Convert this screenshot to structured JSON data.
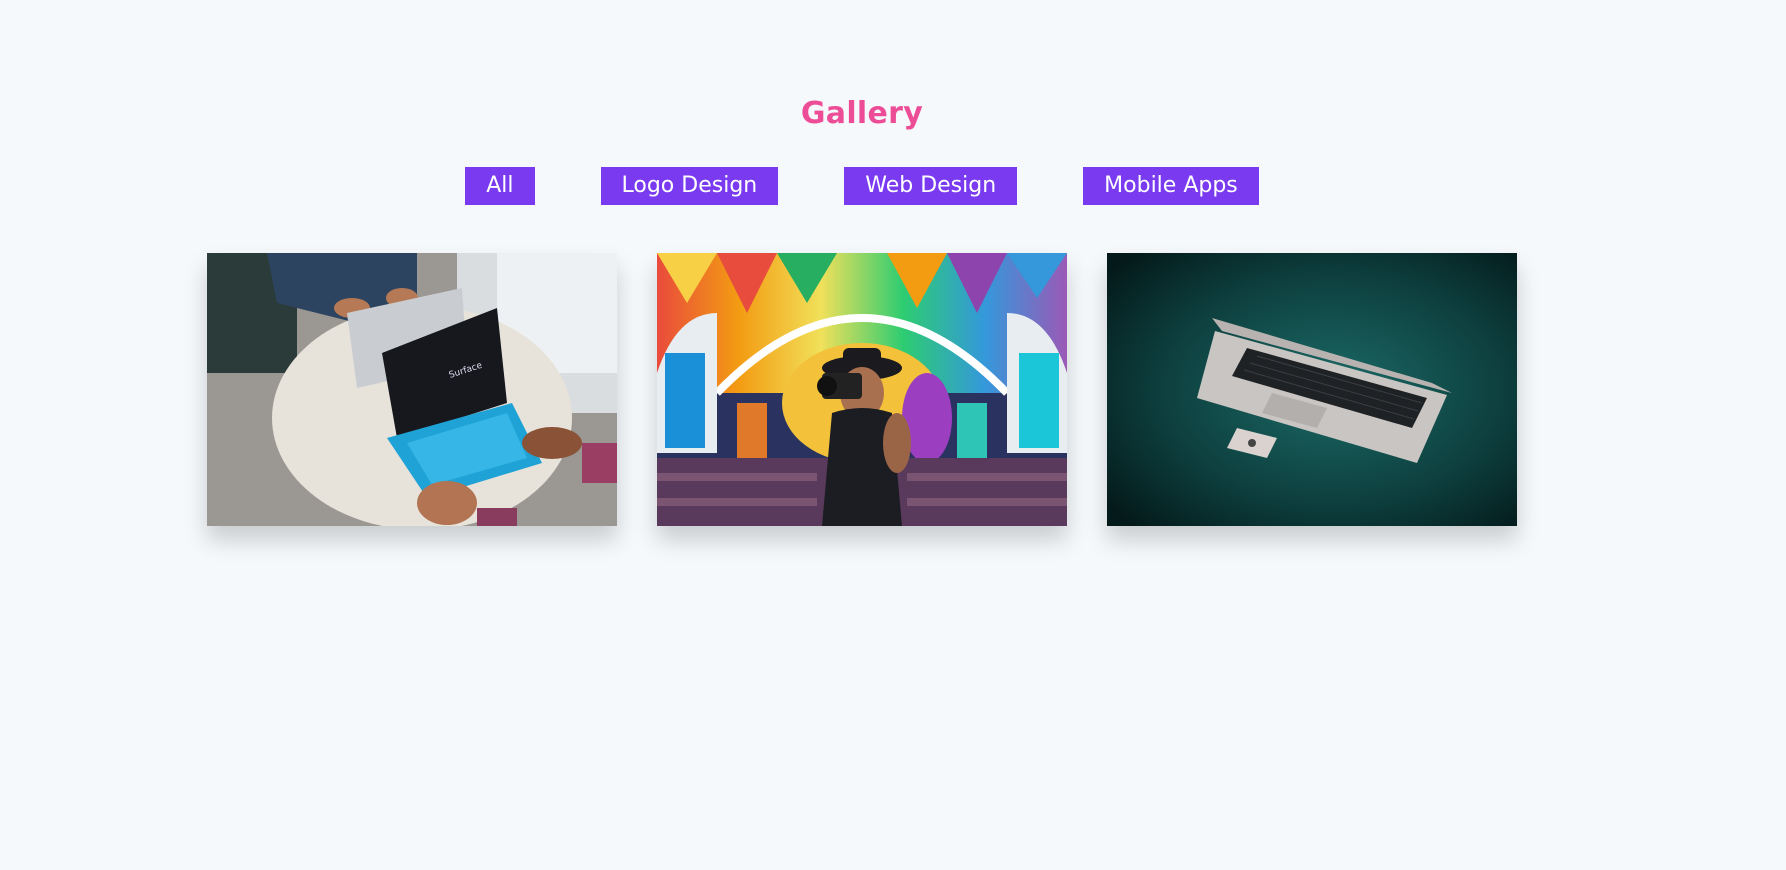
{
  "gallery": {
    "title": "Gallery",
    "filters": [
      {
        "label": "All"
      },
      {
        "label": "Logo Design"
      },
      {
        "label": "Web Design"
      },
      {
        "label": "Mobile Apps"
      }
    ],
    "images": [
      {
        "screen_text": "Surface"
      },
      {},
      {}
    ]
  },
  "colors": {
    "background": "#f5f9fb",
    "title": "#ec4d96",
    "button": "#7a3bf0",
    "button_text": "#ffffff"
  }
}
